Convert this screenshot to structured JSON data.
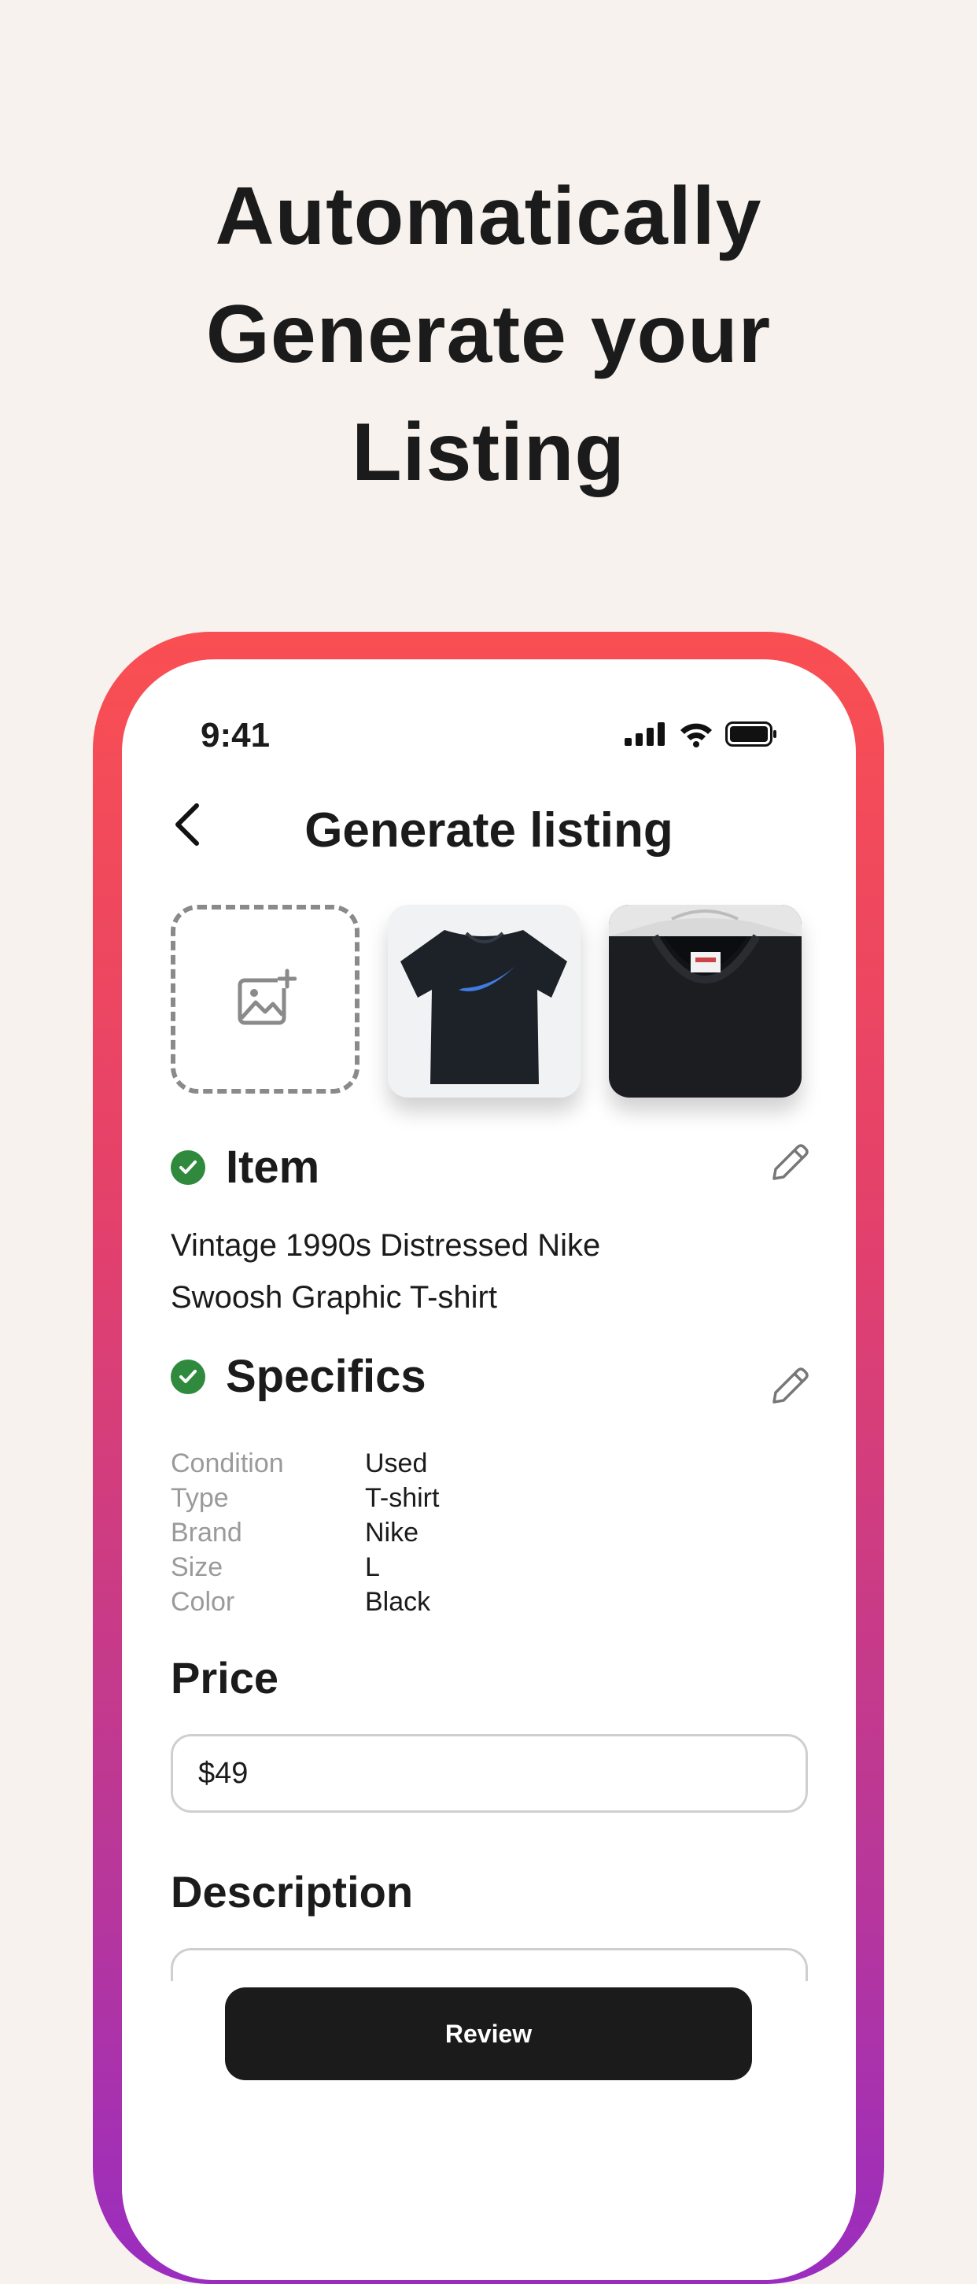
{
  "headline": {
    "line1": "Automatically",
    "line2": "Generate your",
    "line3": "Listing"
  },
  "status_bar": {
    "time": "9:41"
  },
  "nav": {
    "title": "Generate listing"
  },
  "photos": {
    "add_icon": "add-photo-icon",
    "items": [
      "black-tshirt-front",
      "black-tshirt-collar"
    ]
  },
  "item": {
    "title": "Item",
    "description_line1": "Vintage 1990s Distressed Nike",
    "description_line2": "Swoosh Graphic T-shirt"
  },
  "specifics": {
    "title": "Specifics",
    "rows": [
      {
        "key": "Condition",
        "value": "Used"
      },
      {
        "key": "Type",
        "value": "T-shirt"
      },
      {
        "key": "Brand",
        "value": "Nike"
      },
      {
        "key": "Size",
        "value": "L"
      },
      {
        "key": "Color",
        "value": "Black"
      }
    ]
  },
  "price": {
    "label": "Price",
    "value": "$49"
  },
  "description": {
    "label": "Description"
  },
  "actions": {
    "review_label": "Review"
  },
  "colors": {
    "background": "#f7f2ee",
    "check_green": "#2f8a3d",
    "frame_gradient_top": "#f94f52",
    "frame_gradient_bottom": "#9a2dc0",
    "button_dark": "#1b1b1b"
  }
}
